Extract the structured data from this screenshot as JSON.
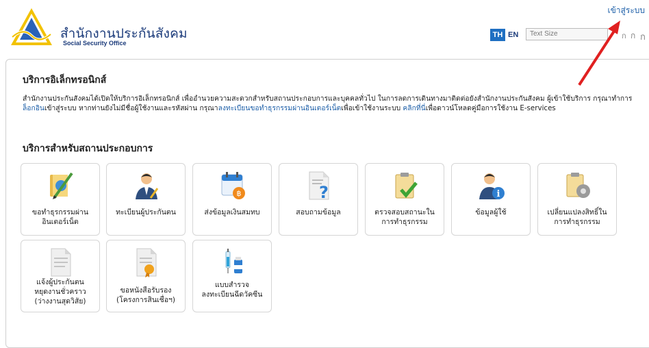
{
  "header": {
    "login_link": "เข้าสู่ระบบ",
    "brand_th": "สำนักงานประกันสังคม",
    "brand_en": "Social Security Office",
    "lang_th": "TH",
    "lang_en": "EN",
    "text_size_label": "Text Size",
    "text_size_options": [
      "ก",
      "ก",
      "ก"
    ]
  },
  "main": {
    "title": "บริการอิเล็กทรอนิกส์",
    "intro": {
      "part1": "สำนักงานประกันสังคมได้เปิดให้บริการอิเล็กทรอนิกส์ เพื่ออำนวยความสะดวกสำหรับสถานประกอบการและบุคคลทั่วไป ในการลดการเดินทางมาติดต่อยังสำนักงานประกันสังคม ผู้เข้าใช้บริการ กรุณาทำการ",
      "link_login": "ล็อกอิน",
      "part2": "เข้าสู่ระบบ หากท่านยังไม่มีชื่อผู้ใช้งานและรหัสผ่าน กรุณา",
      "link_register": "ลงทะเบียนขอทำธุรกรรมผ่านอินเตอร์เน็ต",
      "part3": "เพื่อเข้าใช้งานระบบ ",
      "link_here": "คลิกที่นี่",
      "part4": "เพื่อดาวน์โหลดคู่มือการใช้งาน E-services"
    },
    "employer_title": "บริการสำหรับสถานประกอบการ",
    "services": [
      {
        "icon": "notebook-pencil-icon",
        "line1": "ขอทำธุรกรรมผ่าน",
        "line2": "อินเตอร์เน็ต"
      },
      {
        "icon": "person-register-icon",
        "line1": "ทะเบียนผู้ประกันตน",
        "line2": ""
      },
      {
        "icon": "calendar-baht-icon",
        "line1": "ส่งข้อมูลเงินสมทบ",
        "line2": ""
      },
      {
        "icon": "document-question-icon",
        "line1": "สอบถามข้อมูล",
        "line2": ""
      },
      {
        "icon": "clipboard-check-icon",
        "line1": "ตรวจสอบสถานะใน",
        "line2": "การทำธุรกรรม"
      },
      {
        "icon": "user-info-icon",
        "line1": "ข้อมูลผู้ใช้",
        "line2": ""
      },
      {
        "icon": "clipboard-gear-icon",
        "line1": "เปลี่ยนแปลงสิทธิ์ใน",
        "line2": "การทำธุรกรรม"
      },
      {
        "icon": "document-plain-icon",
        "line1": "แจ้งผู้ประกันตน",
        "line2": "หยุดงานชั่วคราว",
        "line3": "(ว่างงานสุดวิสัย)"
      },
      {
        "icon": "document-certificate-icon",
        "line1": "ขอหนังสือรับรอง",
        "line2": "(โครงการสินเชื่อฯ)"
      },
      {
        "icon": "vaccine-icon",
        "line1": "แบบสำรวจ",
        "line2": "ลงทะเบียนฉีดวัคซีน"
      }
    ]
  },
  "colors": {
    "link": "#1d5fa8",
    "brand": "#1a3a7a",
    "lang_active": "#1f6fc2",
    "annotation_arrow": "#e02020"
  }
}
